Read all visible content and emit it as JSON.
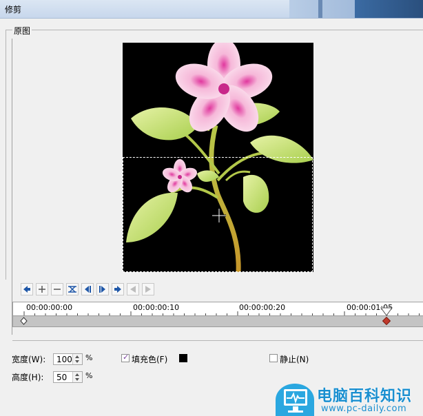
{
  "window": {
    "title": "修剪"
  },
  "group": {
    "label": "原图"
  },
  "toolbar": {
    "buttons": [
      {
        "name": "go-to-start-button",
        "icon": "arrow-left-icon"
      },
      {
        "name": "zoom-in-button",
        "icon": "plus-icon"
      },
      {
        "name": "zoom-out-button",
        "icon": "minus-icon"
      },
      {
        "name": "fit-button",
        "icon": "fit-icon"
      },
      {
        "name": "prev-keyframe-button",
        "icon": "prev-keyframe-icon"
      },
      {
        "name": "next-keyframe-button",
        "icon": "next-keyframe-icon"
      },
      {
        "name": "go-to-end-button",
        "icon": "arrow-right-icon"
      },
      {
        "name": "disabled-button-1",
        "icon": "reverse-icon"
      },
      {
        "name": "disabled-button-2",
        "icon": "forward-icon"
      }
    ]
  },
  "timeline": {
    "timecodes": [
      "00:00:00:00",
      "00:00:00:10",
      "00:00:00:20",
      "00:00:01:05"
    ]
  },
  "fields": {
    "width_label": "宽度(W):",
    "width_value": "100",
    "height_label": "高度(H):",
    "height_value": "50",
    "percent": "%",
    "fill_label": "填充色(F)",
    "fill_checked": true,
    "fill_color": "#000000",
    "still_label": "静止(N)",
    "still_checked": false
  },
  "watermark": {
    "brand": "电脑百科知识",
    "url": "www.pc-daily.com"
  }
}
